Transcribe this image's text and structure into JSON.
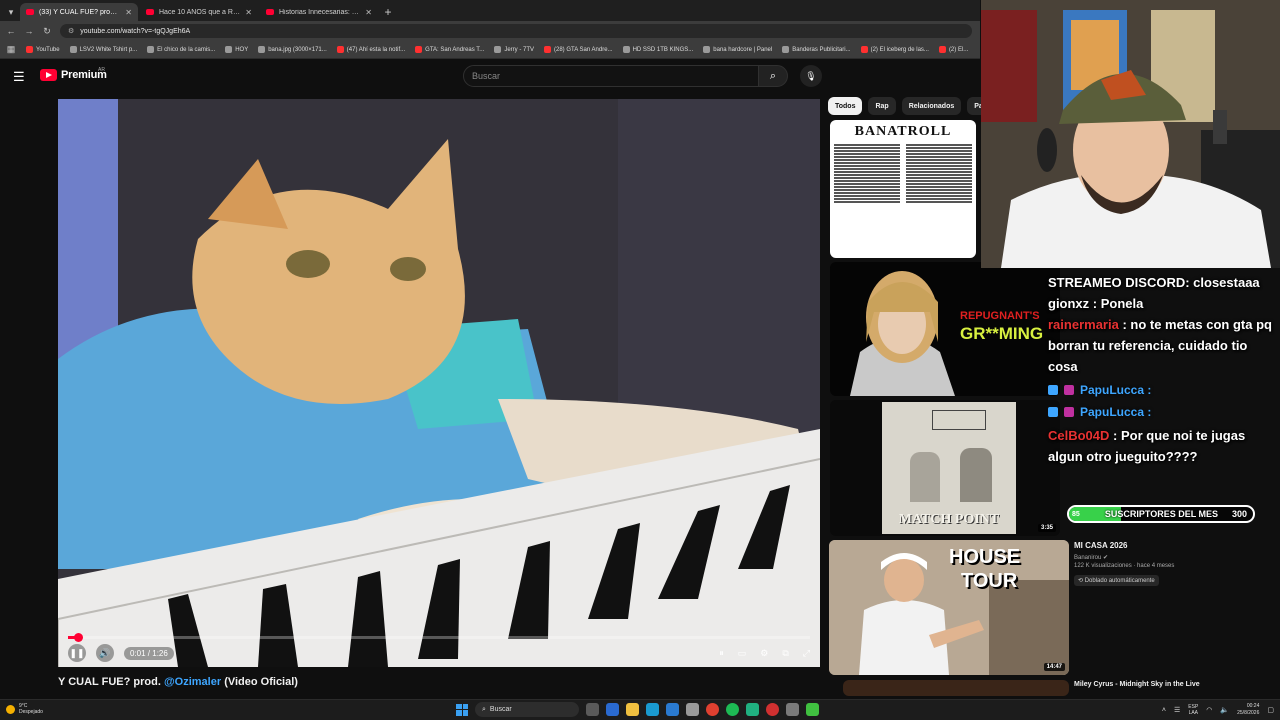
{
  "browser": {
    "tabs": [
      {
        "title": "(33) Y CUAL FUE? prod. @Ozi",
        "active": true
      },
      {
        "title": "Hace 10 AÑOS que a Rockstar",
        "active": false
      },
      {
        "title": "Historias Innecesarias: Counter",
        "active": false
      }
    ],
    "address": "youtube.com/watch?v=-tgQJgEh6A",
    "bookmarks": [
      "YouTube",
      "LSV2 White Tshirt p...",
      "El chico de la camis...",
      "HOY",
      "bana.jpg (3000×171...",
      "(47) Ahí esta la notif...",
      "GTA: San Andreas T...",
      "Jerry - 7TV",
      "(28) GTA San Andre...",
      "HD SSD 1TB KINGS...",
      "bana hardcore | Panel",
      "Banderas Publicitari...",
      "(2) El iceberg de las...",
      "(2) El..."
    ]
  },
  "youtube": {
    "logo_text": "Premium",
    "country": "AR",
    "search_placeholder": "Buscar"
  },
  "player": {
    "time": "0:01 / 1:26",
    "progress": 0.013
  },
  "video": {
    "title_before": "Y CUAL FUE? prod. ",
    "title_mention": "@Ozimaler",
    "title_after": " (Video Oficial)"
  },
  "chips": [
    "Todos",
    "Rap",
    "Relacionados",
    "Pa"
  ],
  "recs": {
    "banatroll_title": "BANATROLL",
    "grooming_text_1": "REPUGNANT'S",
    "grooming_text_2": "GR**MING",
    "matchpoint_text": "MATCH POINT",
    "matchpoint_duration": "3:35",
    "house": {
      "thumb_line1": "HOUSE",
      "thumb_line2": "TOUR",
      "duration": "14:47",
      "title": "MI CASA 2026",
      "channel": "Bananirou",
      "views": "122 K visualizaciones · hace 4 meses",
      "badge": "Doblado automáticamente"
    },
    "next_title": "Miley Cyrus - Midnight Sky in the Live"
  },
  "chat": {
    "messages": [
      {
        "nick": "",
        "text": "STREAMEO DISCORD: closestaaa",
        "nick_color": "white"
      },
      {
        "nick": "gionxz",
        "text": " : Ponela",
        "nick_color": "white"
      },
      {
        "nick": "rainermaria",
        "text": " : no te metas con gta pq borran tu referencia, cuidado tio cosa",
        "nick_color": "red"
      }
    ],
    "dim_users": [
      "PapuLucca :",
      "PapuLucca :"
    ],
    "last": {
      "nick": "CelBo04D",
      "text": " : Por que noi te jugas algun otro jueguito????"
    }
  },
  "subgoal": {
    "current": "85",
    "label": "SUSCRIPTORES DEL MES",
    "goal": "300",
    "fraction": 0.283
  },
  "taskbar": {
    "weather_temp": "9°C",
    "weather_desc": "Despejado",
    "search_label": "Buscar",
    "lang": "ESP",
    "lang2": "LAA",
    "time": "00:24",
    "date": "25/8/2026"
  }
}
